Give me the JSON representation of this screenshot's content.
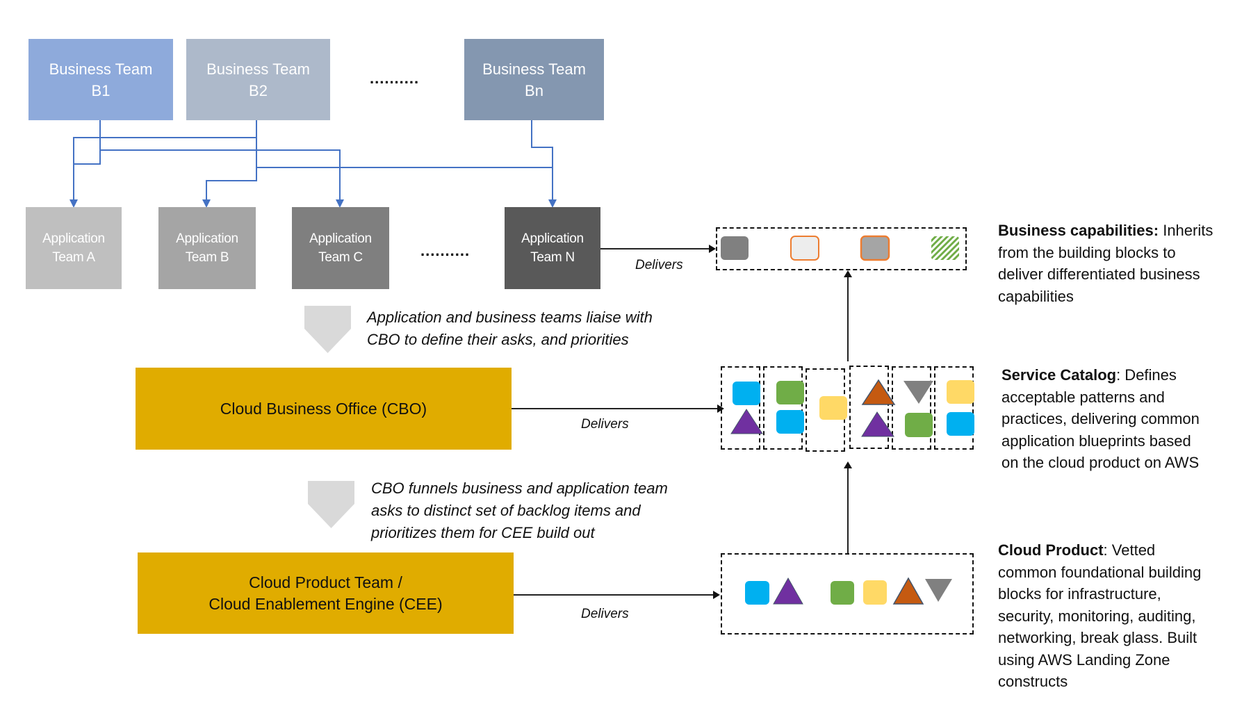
{
  "business_teams": [
    {
      "line1": "Business Team",
      "line2": "B1",
      "color": "#8eaadb"
    },
    {
      "line1": "Business Team",
      "line2": "B2",
      "color": "#adb9ca"
    },
    {
      "line1": "Business Team",
      "line2": "Bn",
      "color": "#8497b0"
    }
  ],
  "business_ellipsis": "..........",
  "application_teams": [
    {
      "line1": "Application",
      "line2": "Team A",
      "color": "#bfbfbf"
    },
    {
      "line1": "Application",
      "line2": "Team B",
      "color": "#a5a5a5"
    },
    {
      "line1": "Application",
      "line2": "Team C",
      "color": "#7f7f7f"
    },
    {
      "line1": "Application",
      "line2": "Team N",
      "color": "#595959"
    }
  ],
  "application_ellipsis": "..........",
  "flow_notes": [
    {
      "lines": [
        "Application and business teams liaise with",
        "CBO to define their asks, and priorities"
      ]
    },
    {
      "lines": [
        "CBO funnels business and application team",
        "asks to distinct set of backlog items and",
        "prioritizes them for CEE build out"
      ]
    }
  ],
  "cbo": {
    "label": "Cloud Business Office (CBO)",
    "color": "#e0ac00"
  },
  "cee": {
    "line1": "Cloud Product Team /",
    "line2": "Cloud Enablement Engine (CEE)",
    "color": "#e0ac00"
  },
  "delivers_label": "Delivers",
  "colors": {
    "connector": "#4472c4",
    "chevron": "#d9d9d9",
    "blue": "#00b0f0",
    "green": "#70ad47",
    "yellow": "#ffd966",
    "purple": "#7030a0",
    "orange": "#c55a11",
    "gray": "#808080",
    "outline_orange": "#ed7d31"
  },
  "descriptions": {
    "business_capabilities": {
      "title": "Business capabilities:",
      "lines": [
        " Inherits",
        "from the building blocks to",
        "deliver differentiated business",
        "capabilities"
      ]
    },
    "service_catalog": {
      "title": "Service Catalog",
      "lines": [
        ": Defines",
        "acceptable patterns and",
        "practices, delivering common",
        "application blueprints based",
        "on the cloud product on AWS"
      ]
    },
    "cloud_product": {
      "title": "Cloud Product",
      "lines": [
        ": Vetted",
        "common foundational building",
        "blocks for infrastructure,",
        "security, monitoring, auditing,",
        "networking, break glass. Built",
        "using AWS Landing Zone",
        "constructs"
      ]
    }
  },
  "capability_items": [
    "gray-square",
    "light-square-orange-outline",
    "gray-square-orange-outline",
    "green-hatched-square"
  ],
  "catalog_columns": [
    [
      "blue-square",
      "purple-triangle"
    ],
    [
      "green-square",
      "blue-square"
    ],
    [
      "yellow-square"
    ],
    [
      "orange-triangle",
      "purple-triangle"
    ],
    [
      "gray-inverted-triangle",
      "green-square"
    ],
    [
      "yellow-square",
      "blue-square"
    ]
  ],
  "product_items": [
    "blue-square",
    "purple-triangle",
    "green-square",
    "yellow-square",
    "orange-triangle",
    "gray-inverted-triangle"
  ]
}
